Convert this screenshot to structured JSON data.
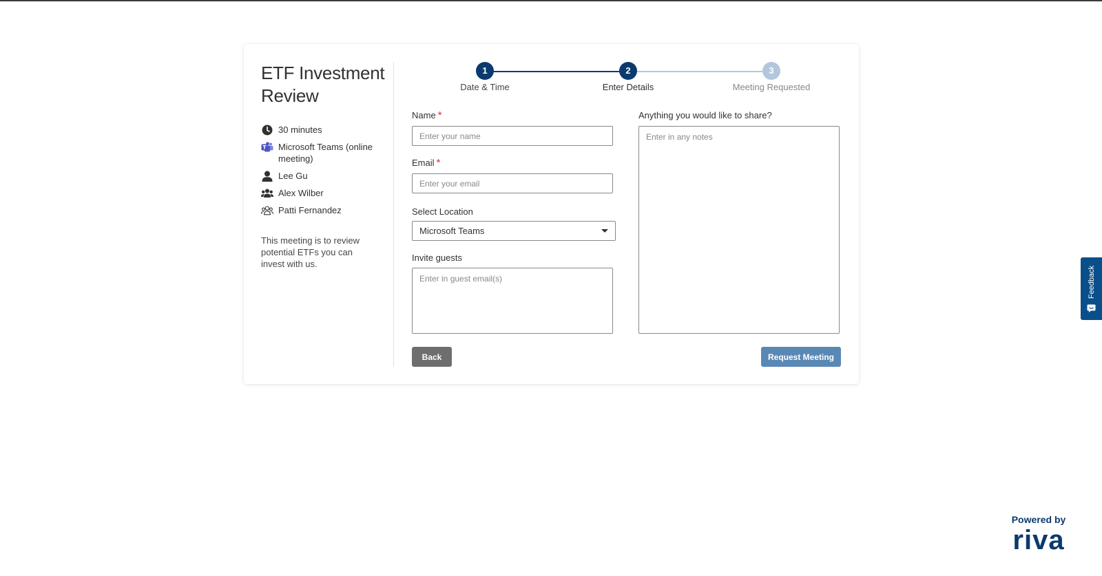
{
  "meeting": {
    "title": "ETF Investment Review",
    "duration": "30 minutes",
    "location": "Microsoft Teams  (online meeting)",
    "host": "Lee Gu",
    "attendee_1": "Alex Wilber",
    "attendee_2": "Patti Fernandez",
    "description": "This meeting is to review potential ETFs you can invest with us."
  },
  "stepper": {
    "steps": [
      {
        "number": "1",
        "label": "Date & Time",
        "state": "done"
      },
      {
        "number": "2",
        "label": "Enter Details",
        "state": "active"
      },
      {
        "number": "3",
        "label": "Meeting Requested",
        "state": "todo"
      }
    ]
  },
  "form": {
    "name_label": "Name",
    "name_placeholder": "Enter your name",
    "email_label": "Email",
    "email_placeholder": "Enter your email",
    "required_mark": "*",
    "location_label": "Select Location",
    "location_value": "Microsoft Teams",
    "guests_label": "Invite guests",
    "guests_placeholder": "Enter in guest email(s)",
    "notes_label": "Anything you would like to share?",
    "notes_placeholder": "Enter in any notes",
    "back_label": "Back",
    "request_label": "Request Meeting"
  },
  "feedback": {
    "label": "Feedback"
  },
  "footer": {
    "powered_by": "Powered by",
    "logo_text": "riva"
  },
  "colors": {
    "primary": "#0b3a6e",
    "step_inactive": "#b3c7dc",
    "request_button": "#5a88b5",
    "back_button": "#6e6e6e",
    "required": "#d13438",
    "teams": "#5059c9"
  },
  "icons": {
    "duration": "clock-icon",
    "location": "teams-icon",
    "host": "person-icon",
    "attendee_1": "people-icon",
    "attendee_2": "people-outline-icon",
    "location_dropdown": "caret-down-icon",
    "feedback": "feedback-icon"
  }
}
